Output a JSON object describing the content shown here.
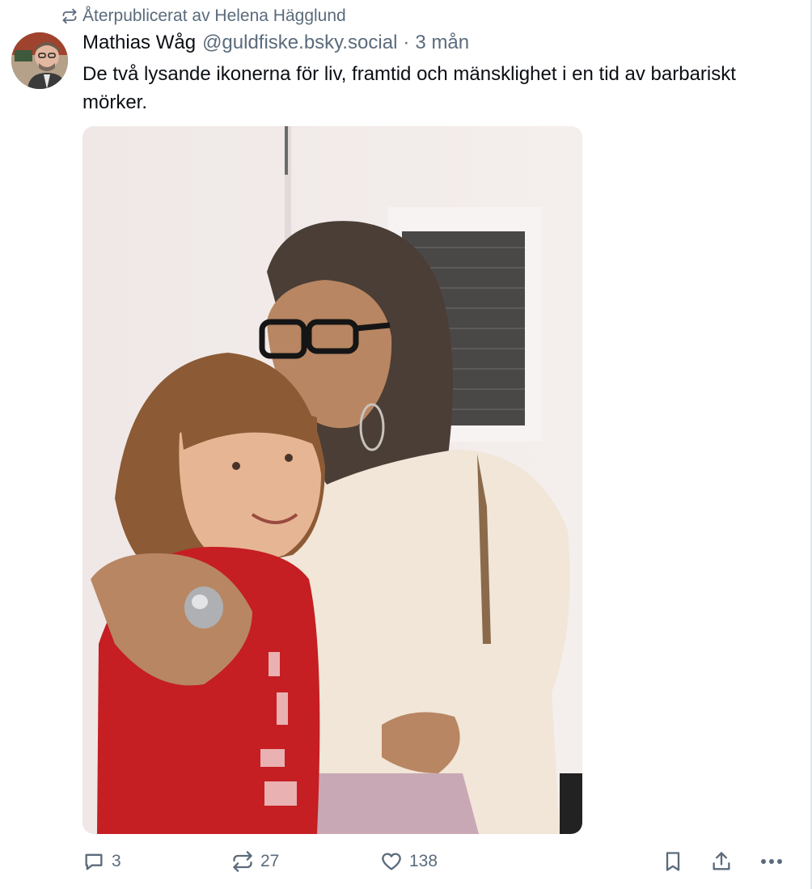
{
  "repost": {
    "icon": "repost-icon",
    "text": "Återpublicerat av Helena Hägglund"
  },
  "post": {
    "author_name": "Mathias Wåg",
    "author_handle": "@guldfiske.bsky.social",
    "separator": "·",
    "time": "3 mån",
    "text": "De två lysande ikonerna för liv, framtid och mänsklighet i en tid av barbariskt mörker."
  },
  "actions": {
    "reply_count": "3",
    "repost_count": "27",
    "like_count": "138"
  },
  "icons": {
    "reply": "reply-icon",
    "repost": "repost-icon",
    "like": "heart-icon",
    "bookmark": "bookmark-icon",
    "share": "share-icon",
    "more": "more-icon"
  },
  "colors": {
    "text_primary": "#0b0f14",
    "text_secondary": "#5b6b7c",
    "background": "#ffffff"
  }
}
